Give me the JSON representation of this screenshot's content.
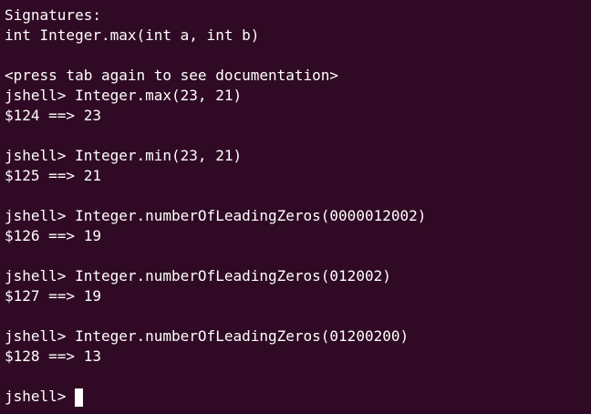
{
  "terminal": {
    "lines": [
      "Signatures:",
      "int Integer.max(int a, int b)",
      "",
      "<press tab again to see documentation>",
      "jshell> Integer.max(23, 21)",
      "$124 ==> 23",
      "",
      "jshell> Integer.min(23, 21)",
      "$125 ==> 21",
      "",
      "jshell> Integer.numberOfLeadingZeros(0000012002)",
      "$126 ==> 19",
      "",
      "jshell> Integer.numberOfLeadingZeros(012002)",
      "$127 ==> 19",
      "",
      "jshell> Integer.numberOfLeadingZeros(01200200)",
      "$128 ==> 13",
      ""
    ],
    "prompt": "jshell> "
  },
  "colors": {
    "background": "#300a24",
    "foreground": "#ffffff"
  }
}
